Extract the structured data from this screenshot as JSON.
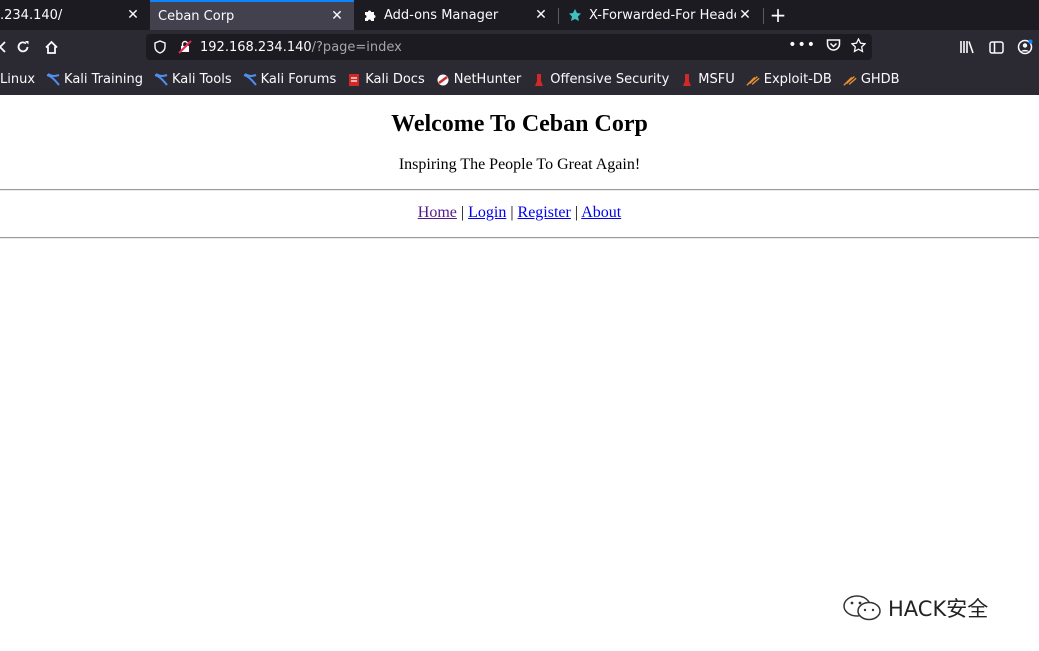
{
  "tabs": [
    {
      "title": ".234.140/",
      "active": false
    },
    {
      "title": "Ceban Corp",
      "active": true
    },
    {
      "title": "Add-ons Manager",
      "active": false
    },
    {
      "title": "X-Forwarded-For Heade",
      "active": false
    }
  ],
  "close_glyph": "✕",
  "new_tab_glyph": "+",
  "urlbar": {
    "host": "192.168.234.140",
    "path": "/?page=index"
  },
  "bookmarks": [
    {
      "label": "Linux",
      "icon": "kali-icon"
    },
    {
      "label": "Kali Training",
      "icon": "kali-icon"
    },
    {
      "label": "Kali Tools",
      "icon": "kali-icon"
    },
    {
      "label": "Kali Forums",
      "icon": "kali-icon"
    },
    {
      "label": "Kali Docs",
      "icon": "kali-docs-icon"
    },
    {
      "label": "NetHunter",
      "icon": "nethunter-icon"
    },
    {
      "label": "Offensive Security",
      "icon": "offsec-icon"
    },
    {
      "label": "MSFU",
      "icon": "offsec-icon"
    },
    {
      "label": "Exploit-DB",
      "icon": "exploitdb-icon"
    },
    {
      "label": "GHDB",
      "icon": "exploitdb-icon"
    }
  ],
  "page": {
    "title": "Welcome To Ceban Corp",
    "tagline": "Inspiring The People To Great Again!",
    "nav": [
      {
        "label": "Home",
        "visited": true
      },
      {
        "label": "Login",
        "visited": false
      },
      {
        "label": "Register",
        "visited": false
      },
      {
        "label": "About",
        "visited": false
      }
    ],
    "separator": "|"
  },
  "watermark": "HACK安全",
  "colors": {
    "accent": "#0b84ff",
    "link": "#0000ee",
    "visited": "#551a8b",
    "chrome_dark": "#1c1b22",
    "chrome": "#2b2a33"
  }
}
